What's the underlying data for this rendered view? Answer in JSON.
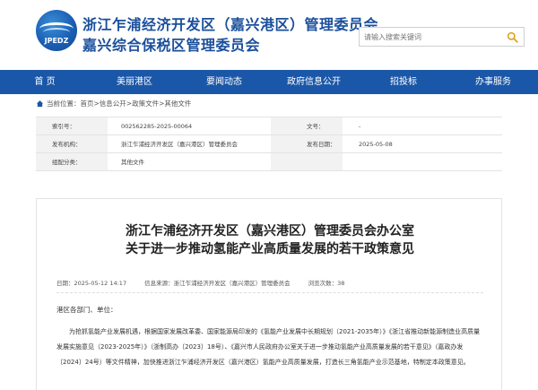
{
  "header": {
    "logo_text": "JPEDZ",
    "title_line1": "浙江乍浦经济开发区（嘉兴港区）管理委员会",
    "title_line2": "嘉兴综合保税区管理委员会",
    "search_placeholder": "请输入搜索关键词"
  },
  "nav": {
    "items": [
      "首 页",
      "美丽港区",
      "要闻动态",
      "政府信息公开",
      "招投标",
      "办事服务"
    ]
  },
  "breadcrumb": {
    "prefix": "当前位置：",
    "items": [
      "首页",
      "信息公开",
      "政策文件",
      "其他文件"
    ],
    "separator": " > "
  },
  "meta": {
    "index_label": "索引号：",
    "index_value": "002562285-2025-00064",
    "docno_label": "文号：",
    "docno_value": "-",
    "org_label": "发布机构：",
    "org_value": "浙江乍浦经济开发区（嘉兴港区）管理委员会",
    "date_label": "发布日期：",
    "date_value": "2025-05-08",
    "cat_label": "组配分类：",
    "cat_value": "其他文件"
  },
  "document": {
    "title_line1": "浙江乍浦经济开发区（嘉兴港区）管理委员会办公室",
    "title_line2": "关于进一步推动氢能产业高质量发展的若干政策意见",
    "date": "日期：2025-05-12 14:17",
    "source": "信息来源：浙江乍浦经济开发区（嘉兴港区）管理委员会",
    "views": "浏览次数：38",
    "greeting": "港区各部门、单位：",
    "body": "为抢抓氢能产业发展机遇，根据国家发展改革委、国家能源局印发的《氢能产业发展中长期规划（2021-2035年）》《浙江省推动新能源制造业高质量发展实施意见（2023-2025年）》（浙制高办〔2023〕18号）、《嘉兴市人民政府办公室关于进一步推动氢能产业高质量发展的若干意见》（嘉政办发〔2024〕24号）等文件精神，加快推进浙江乍浦经济开发区（嘉兴港区）氢能产业高质量发展，打造长三角氢能产业示范基地，特制定本政策意见。"
  }
}
